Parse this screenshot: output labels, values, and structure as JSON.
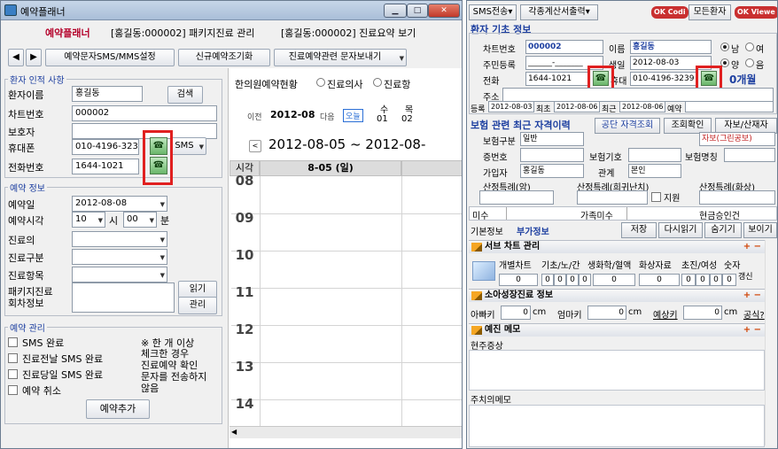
{
  "left": {
    "title": "예약플래너",
    "tabs": [
      "예약플래너",
      "[홍길동:000002]  패키지진료 관리",
      "[홍길동:000002]  진료요약 보기"
    ],
    "toolbar": {
      "sms_setting": "예약문자SMS/MMS설정",
      "new_reservation": "신규예약조기화",
      "send_msg": "진료예약관련 문자보내기"
    },
    "patient": {
      "title": "환자 인적 사항",
      "name_label": "환자이름",
      "name_value": "홍길동",
      "search_button": "검색",
      "chart_label": "차트번호",
      "chart_value": "000002",
      "guardian_label": "보호자",
      "guardian_value": "",
      "mobile_label": "휴대폰",
      "mobile_value": "010-4196-323",
      "sms_button": "SMS",
      "phone_label": "전화번호",
      "phone_value": "1644-1021"
    },
    "reservation": {
      "title": "예약 정보",
      "date_label": "예약일",
      "date_value": "2012-08-08",
      "time_label": "예약시각",
      "hour_value": "10",
      "hour_unit": "시",
      "minute_value": "00",
      "minute_unit": "분",
      "doctor_label": "진료의",
      "type_label": "진료구분",
      "item_label": "진료항목",
      "package_label_1": "패키지진료",
      "package_label_2": "회차정보",
      "read_button": "읽기",
      "manage_button": "관리"
    },
    "management": {
      "title": "예약 관리",
      "sms_done": "SMS 완료",
      "prev_day_sms": "진료전날 SMS 완료",
      "same_day_sms": "진료당일 SMS 완료",
      "cancel": "예약 취소",
      "note": [
        "※ 한 개 이상",
        "체크한 경우",
        "진료예약 확인",
        "문자를 전송하지",
        "않음"
      ],
      "add_button": "예약추가"
    },
    "calendar": {
      "status_title": "한의원예약현황",
      "radio_doctor": "진료의사",
      "radio_room": "진료항",
      "prev": "이전",
      "month": "2012-08",
      "next": "다음",
      "today": "오늘",
      "wed": "수",
      "wed_day": "01",
      "thu": "목",
      "thu_day": "02",
      "range": "2012-08-05 ~ 2012-08-",
      "time_header": "시각",
      "day_header": "8-05 (일)",
      "hours": [
        "08",
        "09",
        "10",
        "11",
        "12",
        "13",
        "14"
      ]
    }
  },
  "right": {
    "top": {
      "sms_send": "SMS전송",
      "invoice_print": "각종계산서출력",
      "ok_codi": "OK Codi",
      "all_patients": "모든환자",
      "ok_viewer": "OK Viewe"
    },
    "basic": {
      "title": "환자 기초 정보",
      "chart_label": "차트번호",
      "chart_value": "000002",
      "name_label": "이름",
      "name_value": "홍길동",
      "sex_male": "남",
      "sex_female": "여",
      "rrn_label": "주민등록",
      "rrn_value": "______-_______",
      "birth_label": "생일",
      "birth_value": "2012-08-03",
      "solar": "양",
      "lunar": "음",
      "phone_label": "전화",
      "phone_value": "1644-1021",
      "mobile_label": "휴대",
      "mobile_value": "010-4196-3239",
      "age": "0개월",
      "address_label": "주소",
      "reg_label": "등록",
      "reg_value": "2012-08-03",
      "first_label": "최초",
      "first_value": "2012-08-06",
      "last_label": "최근",
      "last_value": "2012-08-06",
      "reserve_label": "예약"
    },
    "insurance": {
      "title": "보험 관련 최근 자격이력",
      "public_check": "공단 자격조회",
      "check": "조회확인",
      "self_burden": "자보/산재자",
      "type_label": "보험구분",
      "type_value": "일반",
      "self_note": "자보(그린공보)",
      "cert_label": "증번호",
      "insurer_label": "보험기호",
      "insurer_name_label": "보험명칭",
      "holder_label": "가입자",
      "holder_value": "홍길동",
      "relation_label": "관계",
      "relation_value": "본인",
      "special_cancer": "산정특례(암)",
      "special_rare": "산정특례(희귀난치)",
      "special_burn": "산정특례(화상)",
      "support": "지원"
    },
    "balance": {
      "unpaid": "미수",
      "family_unpaid": "가족미수",
      "cash_receipt": "현금승인건"
    },
    "subtabs": {
      "basic": "기본정보",
      "extra": "부가정보",
      "save": "저장",
      "reload": "다시읽기",
      "hide": "숨기기",
      "show": "보이기"
    },
    "subchart": {
      "title": "서브 차트 관리",
      "cols": [
        "개별차트",
        "기초/노/간",
        "생화학/혈액",
        "화상자료",
        "초진/여성",
        "숫자"
      ],
      "refresh": "갱신",
      "values": [
        "0",
        "0",
        "0",
        "0",
        "0",
        "0",
        "0",
        "0",
        "0",
        "0",
        "0"
      ]
    },
    "growth": {
      "title": "소아성장진료 정보",
      "father_label": "아빠키",
      "father_value": "0",
      "mother_label": "엄마키",
      "mother_value": "0",
      "expected_label": "예상키",
      "expected_value": "0",
      "unit": "cm",
      "formula": "공식?"
    },
    "memo": {
      "title": "예진 메모",
      "symptom_label": "현주증상",
      "caution_label": "주치의메모"
    },
    "plusminus": "+ −"
  }
}
